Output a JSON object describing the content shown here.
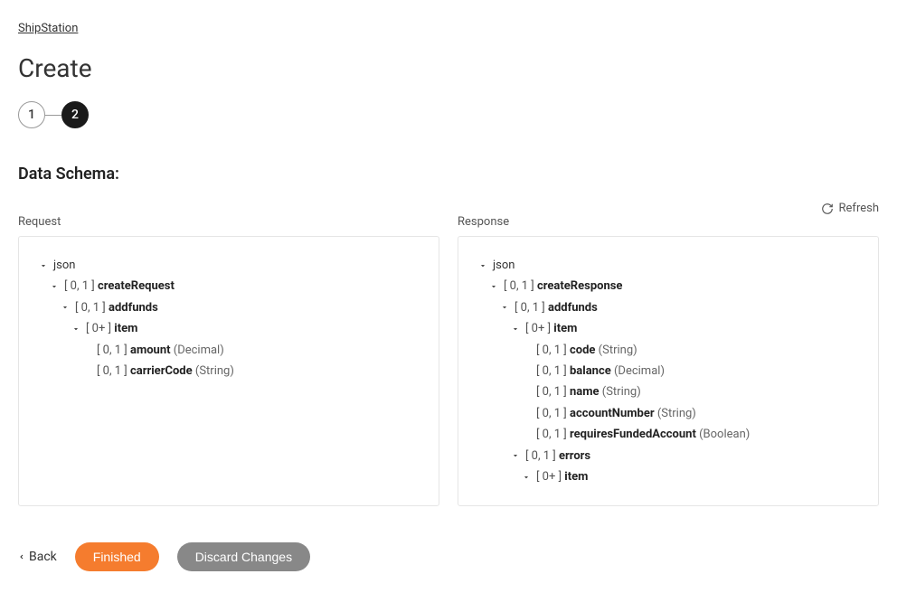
{
  "breadcrumb": {
    "label": "ShipStation"
  },
  "page": {
    "title": "Create"
  },
  "stepper": {
    "step1": "1",
    "step2": "2"
  },
  "schema": {
    "title": "Data Schema:",
    "refresh": "Refresh",
    "request": {
      "label": "Request",
      "root": "json",
      "nodes": {
        "createRequest": {
          "card": "[ 0, 1 ]",
          "name": "createRequest"
        },
        "addfunds": {
          "card": "[ 0, 1 ]",
          "name": "addfunds"
        },
        "item": {
          "card": "[ 0+ ]",
          "name": "item"
        },
        "amount": {
          "card": "[ 0, 1 ]",
          "name": "amount",
          "type": "(Decimal)"
        },
        "carrierCode": {
          "card": "[ 0, 1 ]",
          "name": "carrierCode",
          "type": "(String)"
        }
      }
    },
    "response": {
      "label": "Response",
      "root": "json",
      "nodes": {
        "createResponse": {
          "card": "[ 0, 1 ]",
          "name": "createResponse"
        },
        "addfunds": {
          "card": "[ 0, 1 ]",
          "name": "addfunds"
        },
        "item": {
          "card": "[ 0+ ]",
          "name": "item"
        },
        "code": {
          "card": "[ 0, 1 ]",
          "name": "code",
          "type": "(String)"
        },
        "balance": {
          "card": "[ 0, 1 ]",
          "name": "balance",
          "type": "(Decimal)"
        },
        "name": {
          "card": "[ 0, 1 ]",
          "name": "name",
          "type": "(String)"
        },
        "accountNumber": {
          "card": "[ 0, 1 ]",
          "name": "accountNumber",
          "type": "(String)"
        },
        "requiresFundedAccount": {
          "card": "[ 0, 1 ]",
          "name": "requiresFundedAccount",
          "type": "(Boolean)"
        },
        "errors": {
          "card": "[ 0, 1 ]",
          "name": "errors"
        },
        "errorsItem": {
          "card": "[ 0+ ]",
          "name": "item"
        }
      }
    }
  },
  "actions": {
    "back": "Back",
    "finished": "Finished",
    "discard": "Discard Changes"
  }
}
